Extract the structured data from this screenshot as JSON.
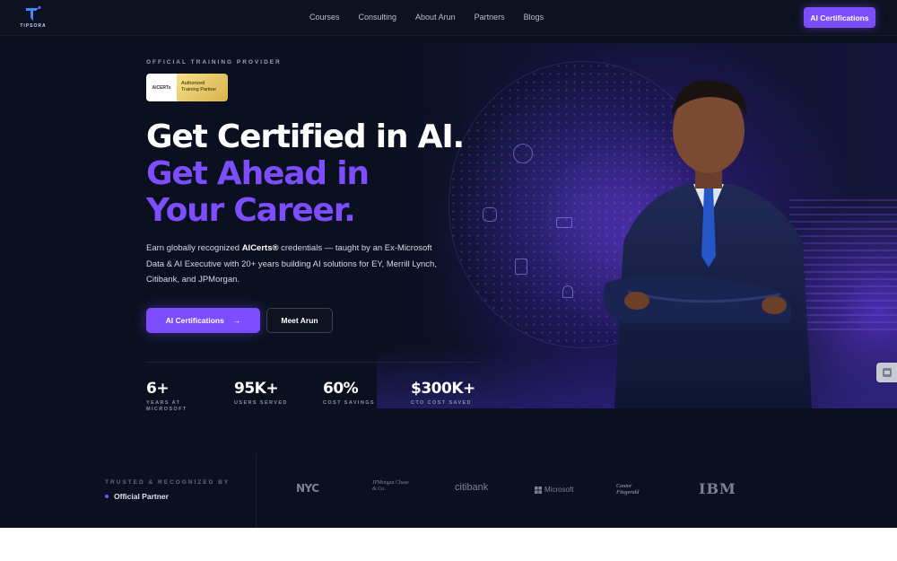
{
  "brand": {
    "logo_text": "TIPSORA"
  },
  "nav": {
    "links": [
      "Courses",
      "Consulting",
      "About Arun",
      "Partners",
      "Blogs"
    ],
    "cta_label": "AI Certifications"
  },
  "hero": {
    "eyebrow": "OFFICIAL TRAINING PROVIDER",
    "badge": {
      "left_text": "AICERTs",
      "right_line1": "Authorized",
      "right_line2": "Training Partner"
    },
    "headline_white": "Get Certified in AI.",
    "headline_purple": "Get Ahead in Your Career.",
    "lede_part1": "Earn globally recognized ",
    "lede_bold": "AICerts®",
    "lede_part2": " credentials — taught by an Ex-Microsoft Data & AI Executive with 20+ years building AI solutions for EY, Merrill Lynch, Citibank, and JPMorgan.",
    "primary_button": "AI Certifications",
    "primary_button_arrow": "→",
    "secondary_button": "Meet Arun"
  },
  "stats": [
    {
      "value": "6+",
      "label": "YEARS AT MICROSOFT"
    },
    {
      "value": "95K+",
      "label": "USERS SERVED"
    },
    {
      "value": "60%",
      "label": "COST SAVINGS"
    },
    {
      "value": "$300K+",
      "label": "CTO COST SAVED"
    }
  ],
  "trust": {
    "label": "TRUSTED & RECOGNIZED BY",
    "partner_label": "Official Partner",
    "logos": [
      "NYC",
      "JPMorgan Chase & Co.",
      "citibank",
      "Microsoft",
      "Cantor Fitzgerald",
      "IBM"
    ]
  },
  "colors": {
    "accent": "#7b4dff",
    "background": "#0b1020"
  }
}
